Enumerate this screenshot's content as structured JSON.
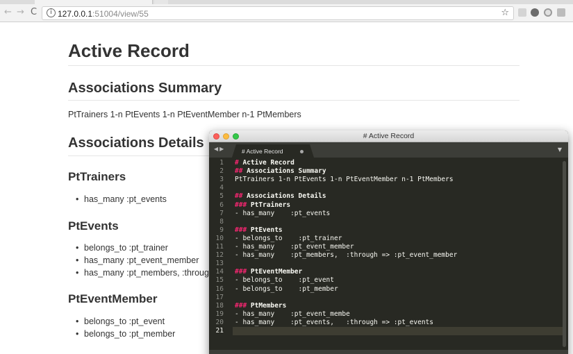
{
  "browser": {
    "url_host": "127.0.0.1",
    "url_rest": ":51004/view/55",
    "back_icon": "←",
    "forward_icon": "→",
    "reload_icon": "C",
    "info_icon": "i",
    "star_icon": "☆"
  },
  "page": {
    "title": "Active Record",
    "assoc_summary_heading": "Associations Summary",
    "assoc_summary_text": "PtTrainers 1-n PtEvents 1-n PtEventMember n-1 PtMembers",
    "assoc_details_heading": "Associations Details",
    "sections": [
      {
        "heading": "PtTrainers",
        "items": [
          "has_many :pt_events"
        ]
      },
      {
        "heading": "PtEvents",
        "items": [
          "belongs_to :pt_trainer",
          "has_many :pt_event_member",
          "has_many :pt_members, :through ="
        ]
      },
      {
        "heading": "PtEventMember",
        "items": [
          "belongs_to :pt_event",
          "belongs_to :pt_member"
        ]
      }
    ]
  },
  "editor": {
    "window_title": "# Active Record",
    "tab_label": "# Active Record",
    "lines": [
      {
        "n": "1",
        "mark": "#",
        "text": " Active Record"
      },
      {
        "n": "2",
        "mark": "##",
        "text": " Associations Summary"
      },
      {
        "n": "3",
        "mark": "",
        "text": "PtTrainers 1-n PtEvents 1-n PtEventMember n-1 PtMembers"
      },
      {
        "n": "4",
        "mark": "",
        "text": ""
      },
      {
        "n": "5",
        "mark": "##",
        "text": " Associations Details"
      },
      {
        "n": "6",
        "mark": "###",
        "text": " PtTrainers"
      },
      {
        "n": "7",
        "mark": "",
        "text": "- has_many    :pt_events"
      },
      {
        "n": "8",
        "mark": "",
        "text": ""
      },
      {
        "n": "9",
        "mark": "###",
        "text": " PtEvents"
      },
      {
        "n": "10",
        "mark": "",
        "text": "- belongs_to    :pt_trainer"
      },
      {
        "n": "11",
        "mark": "",
        "text": "- has_many    :pt_event_member"
      },
      {
        "n": "12",
        "mark": "",
        "text": "- has_many    :pt_members,  :through => :pt_event_member"
      },
      {
        "n": "13",
        "mark": "",
        "text": ""
      },
      {
        "n": "14",
        "mark": "###",
        "text": " PtEventMember"
      },
      {
        "n": "15",
        "mark": "",
        "text": "- belongs_to    :pt_event"
      },
      {
        "n": "16",
        "mark": "",
        "text": "- belongs_to    :pt_member"
      },
      {
        "n": "17",
        "mark": "",
        "text": ""
      },
      {
        "n": "18",
        "mark": "###",
        "text": " PtMembers"
      },
      {
        "n": "19",
        "mark": "",
        "text": "- has_many    :pt_event_membe"
      },
      {
        "n": "20",
        "mark": "",
        "text": "- has_many    :pt_events,   :through => :pt_events"
      },
      {
        "n": "21",
        "mark": "",
        "text": ""
      }
    ],
    "current_line": "21"
  },
  "colors": {
    "editor_bg": "#282923",
    "markdown_mark": "#f92672",
    "text": "#f8f8f2"
  }
}
